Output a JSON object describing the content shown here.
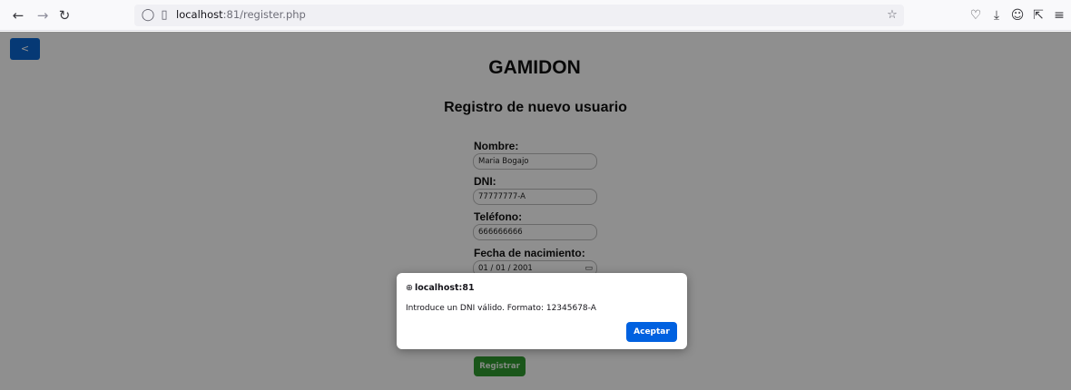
{
  "browser": {
    "url_host": "localhost",
    "url_rest": ":81/register.php",
    "icons": [
      "back-icon",
      "forward-icon",
      "reload-icon",
      "shield-icon",
      "page-icon",
      "bookmark-star-icon",
      "pocket-icon",
      "download-icon",
      "account-icon",
      "extensions-icon",
      "menu-icon"
    ]
  },
  "page": {
    "back_label": "<",
    "site_title": "GAMIDON",
    "form_title": "Registro de nuevo usuario",
    "fields": [
      {
        "label": "Nombre:",
        "value": "Maria Bogajo"
      },
      {
        "label": "DNI:",
        "value": "77777777-A"
      },
      {
        "label": "Teléfono:",
        "value": "666666666"
      },
      {
        "label": "Fecha de nacimiento:",
        "value": "01 / 01 / 2001"
      }
    ],
    "submit_label": "Registrar",
    "colors": {
      "back_button": "#0b67d0",
      "submit_button": "#2f9a2f"
    }
  },
  "dialog": {
    "origin": "localhost:81",
    "message": "Introduce un DNI válido. Formato: 12345678-A",
    "ok_label": "Aceptar",
    "colors": {
      "ok_button": "#0061e0"
    }
  }
}
